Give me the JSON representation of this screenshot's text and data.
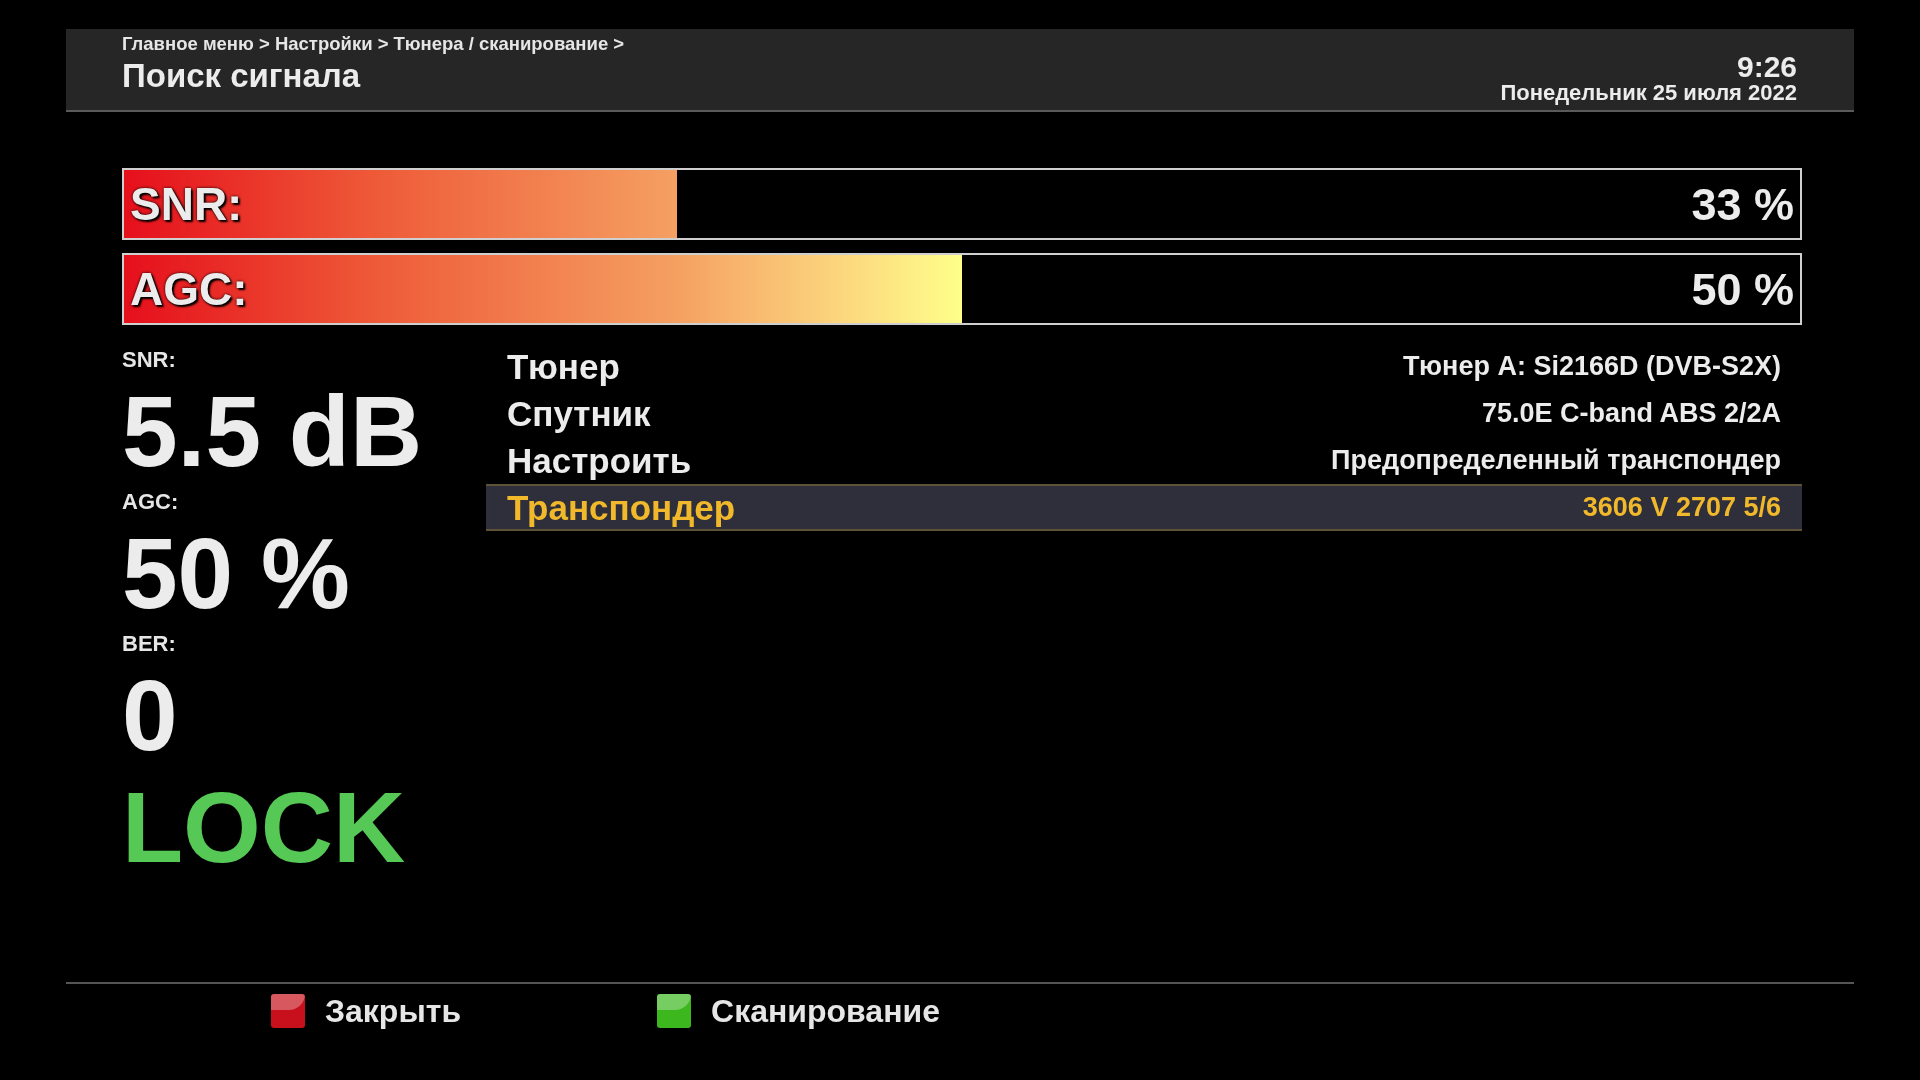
{
  "header": {
    "breadcrumb": "Главное меню > Настройки > Тюнера / сканирование >",
    "title": "Поиск сигнала",
    "time": "9:26",
    "date": "Понедельник 25 июля 2022"
  },
  "meters": [
    {
      "label": "SNR:",
      "level": 0.33,
      "reading": "33 %"
    },
    {
      "label": "AGC:",
      "level": 0.5,
      "reading": "50 %"
    }
  ],
  "stats": [
    {
      "label": "SNR:",
      "value": "5.5 dB"
    },
    {
      "label": "AGC:",
      "value": "50 %"
    },
    {
      "label": "BER:",
      "value": "0"
    }
  ],
  "lock_status": "LOCK",
  "settings": [
    {
      "label": "Тюнер",
      "value": "Тюнер A: Si2166D (DVB-S2X)",
      "selected": false
    },
    {
      "label": "Спутник",
      "value": "75.0E C-band ABS 2/2A",
      "selected": false
    },
    {
      "label": "Настроить",
      "value": "Предопределенный транспондер",
      "selected": false
    },
    {
      "label": "Транспондер",
      "value": "3606 V 2707 5/6",
      "selected": true
    }
  ],
  "footer_buttons": [
    {
      "label": "Закрыть",
      "color": "#c8101c"
    },
    {
      "label": "Сканирование",
      "color": "#3cb81e"
    }
  ]
}
